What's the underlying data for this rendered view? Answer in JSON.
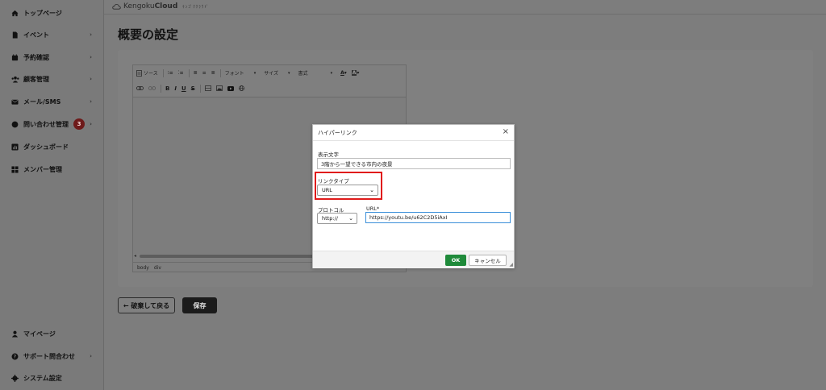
{
  "sidebar": {
    "items": [
      {
        "label": "トップページ",
        "icon": "home-icon",
        "chevron": false
      },
      {
        "label": "イベント",
        "icon": "document-icon",
        "chevron": true
      },
      {
        "label": "予約確認",
        "icon": "calendar-icon",
        "chevron": true
      },
      {
        "label": "顧客管理",
        "icon": "users-icon",
        "chevron": true
      },
      {
        "label": "メール/SMS",
        "icon": "mail-icon",
        "chevron": true
      },
      {
        "label": "問い合わせ管理",
        "icon": "chat-icon",
        "chevron": true,
        "badge": "3"
      },
      {
        "label": "ダッシュボード",
        "icon": "chart-icon",
        "chevron": false
      },
      {
        "label": "メンバー管理",
        "icon": "grid-icon",
        "chevron": false
      }
    ],
    "bottom_items": [
      {
        "label": "マイページ",
        "icon": "person-icon",
        "chevron": false
      },
      {
        "label": "サポート問合わせ",
        "icon": "help-icon",
        "chevron": true
      },
      {
        "label": "システム設定",
        "icon": "gear-icon",
        "chevron": false
      }
    ]
  },
  "header": {
    "logo_prefix": "Kengoku",
    "logo_bold": "Cloud",
    "logo_sub": "ｹﾝｺﾞｸｸﾗｳﾄﾞ"
  },
  "page": {
    "title": "概要の設定",
    "back_label": "← 破棄して戻る",
    "save_label": "保存"
  },
  "editor": {
    "source_label": "ソース",
    "font_label": "フォント",
    "size_label": "サイズ",
    "format_label": "書式",
    "footer_path": [
      "body",
      "div"
    ]
  },
  "dialog": {
    "title": "ハイパーリンク",
    "close": "×",
    "display_text_label": "表示文字",
    "display_text_value": "3階から一望できる市内の夜景",
    "link_type_label": "リンクタイプ",
    "link_type_value": "URL",
    "protocol_label": "プロトコル",
    "protocol_value": "http://",
    "url_label": "URL*",
    "url_value": "https://youtu.be/u62C2D5iAxI",
    "ok_label": "OK",
    "cancel_label": "キャンセル"
  },
  "colors": {
    "overlay": "#7d7d7d",
    "ok_green": "#1f8a3a",
    "highlight_red": "#e01b1b",
    "badge": "#6e1a1a"
  }
}
